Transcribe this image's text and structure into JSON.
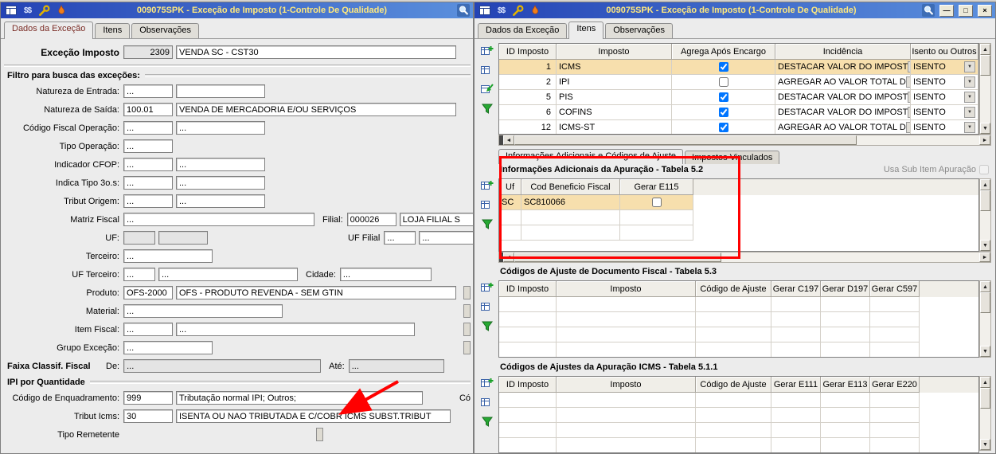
{
  "title": "009075SPK - Exceção de Imposto (1-Controle De Qualidade)",
  "tabs": [
    "Dados da Exceção",
    "Itens",
    "Observações"
  ],
  "icons": {
    "minimize": "—",
    "maximize": "□",
    "close": "×",
    "dollar": "$$",
    "scroll_up": "▲",
    "scroll_down": "▼",
    "scroll_left": "◄",
    "scroll_right": "►",
    "dropdown": "▼"
  },
  "colors": {
    "titlebar_a": "#2443b5",
    "titlebar_b": "#5b90dd",
    "title_text": "#ffe97d",
    "selected_row": "#f7dfad",
    "annotation": "#ff0000"
  },
  "left": {
    "excecao": {
      "label": "Exceção Imposto",
      "code": "2309",
      "desc": "VENDA SC - CST30"
    },
    "filtro_header": "Filtro para busca das exceções:",
    "nat_entrada": {
      "label": "Natureza de Entrada:",
      "v1": "...",
      "v2": ""
    },
    "nat_saida": {
      "label": "Natureza de Saída:",
      "v1": "100.01",
      "v2": "VENDA DE MERCADORIA E/OU SERVIÇOS"
    },
    "cod_fiscal_op": {
      "label": "Código Fiscal Operação:",
      "v1": "...",
      "v2": "..."
    },
    "tipo_op": {
      "label": "Tipo Operação:",
      "v1": "..."
    },
    "ind_cfop": {
      "label": "Indicador CFOP:",
      "v1": "...",
      "v2": "..."
    },
    "indica_tipo": {
      "label": "Indica Tipo 3o.s:",
      "v1": "...",
      "v2": "..."
    },
    "tribut_origem": {
      "label": "Tribut Origem:",
      "v1": "...",
      "v2": "..."
    },
    "matriz": {
      "label": "Matriz Fiscal",
      "v1": "...",
      "filial_label": "Filial:",
      "filial_code": "000026",
      "filial_desc": "LOJA FILIAL S"
    },
    "uf": {
      "label": "UF:",
      "v1": "",
      "v2": "",
      "filial_label": "UF Filial",
      "f1": "...",
      "f2": "..."
    },
    "terceiro": {
      "label": "Terceiro:",
      "v1": "..."
    },
    "uf_terceiro": {
      "label": "UF Terceiro:",
      "v1": "...",
      "v2": "...",
      "cidade_label": "Cidade:",
      "cidade": "..."
    },
    "produto": {
      "label": "Produto:",
      "v1": "OFS-2000",
      "v2": "OFS - PRODUTO REVENDA - SEM GTIN"
    },
    "material": {
      "label": "Material:",
      "v1": "..."
    },
    "item_fiscal": {
      "label": "Item Fiscal:",
      "v1": "...",
      "v2": "..."
    },
    "grupo": {
      "label": "Grupo Exceção:",
      "v1": "..."
    },
    "faixa": {
      "label": "Faixa Classif. Fiscal",
      "de_label": "De:",
      "de": "...",
      "ate_label": "Até:",
      "ate": "..."
    },
    "ipi_header": "IPI por Quantidade",
    "cod_enq": {
      "label": "Código de Enquadramento:",
      "v1": "999",
      "v2": "Tributação normal IPI; Outros;",
      "cut": "Có"
    },
    "tribut_icms": {
      "label": "Tribut Icms:",
      "v1": "30",
      "v2": "ISENTA OU NAO TRIBUTADA E C/COBR ICMS SUBST.TRIBUT"
    },
    "tipo_remetente": {
      "label": "Tipo Remetente"
    }
  },
  "right": {
    "grid": {
      "columns": [
        "ID Imposto",
        "Imposto",
        "Agrega Após Encargo",
        "Incidência",
        "Isento ou Outros"
      ],
      "rows": [
        {
          "id": "1",
          "imposto": "ICMS",
          "agrega": true,
          "incidencia": "DESTACAR VALOR DO IMPOST",
          "isento": "ISENTO"
        },
        {
          "id": "2",
          "imposto": "IPI",
          "agrega": false,
          "incidencia": "AGREGAR AO VALOR TOTAL D",
          "isento": "ISENTO"
        },
        {
          "id": "5",
          "imposto": "PIS",
          "agrega": true,
          "incidencia": "DESTACAR VALOR DO IMPOST",
          "isento": "ISENTO"
        },
        {
          "id": "6",
          "imposto": "COFINS",
          "agrega": true,
          "incidencia": "DESTACAR VALOR DO IMPOST",
          "isento": "ISENTO"
        },
        {
          "id": "12",
          "imposto": "ICMS-ST",
          "agrega": true,
          "incidencia": "AGREGAR AO VALOR TOTAL D",
          "isento": "ISENTO"
        }
      ]
    },
    "subtabs": [
      "Informações Adicionais e Códigos de Ajuste",
      "Impostos Vinculados"
    ],
    "apuracao": {
      "title": "Informações Adicionais da Apuração - Tabela 5.2",
      "usa_sub_item": "Usa Sub Item Apuração",
      "columns": [
        "Uf",
        "Cod Beneficio Fiscal",
        "Gerar E115"
      ],
      "rows": [
        {
          "uf": "SC",
          "cod": "SC810066",
          "gerar_e115": false
        }
      ]
    },
    "doc_fiscal": {
      "title": "Códigos de Ajuste de Documento Fiscal - Tabela 5.3",
      "columns": [
        "ID Imposto",
        "Imposto",
        "Código de Ajuste",
        "Gerar C197",
        "Gerar D197",
        "Gerar C597"
      ]
    },
    "apuracao_icms": {
      "title": "Códigos de Ajustes da Apuração ICMS - Tabela 5.1.1",
      "columns": [
        "ID Imposto",
        "Imposto",
        "Código de Ajuste",
        "Gerar E111",
        "Gerar E113",
        "Gerar E220"
      ]
    }
  }
}
